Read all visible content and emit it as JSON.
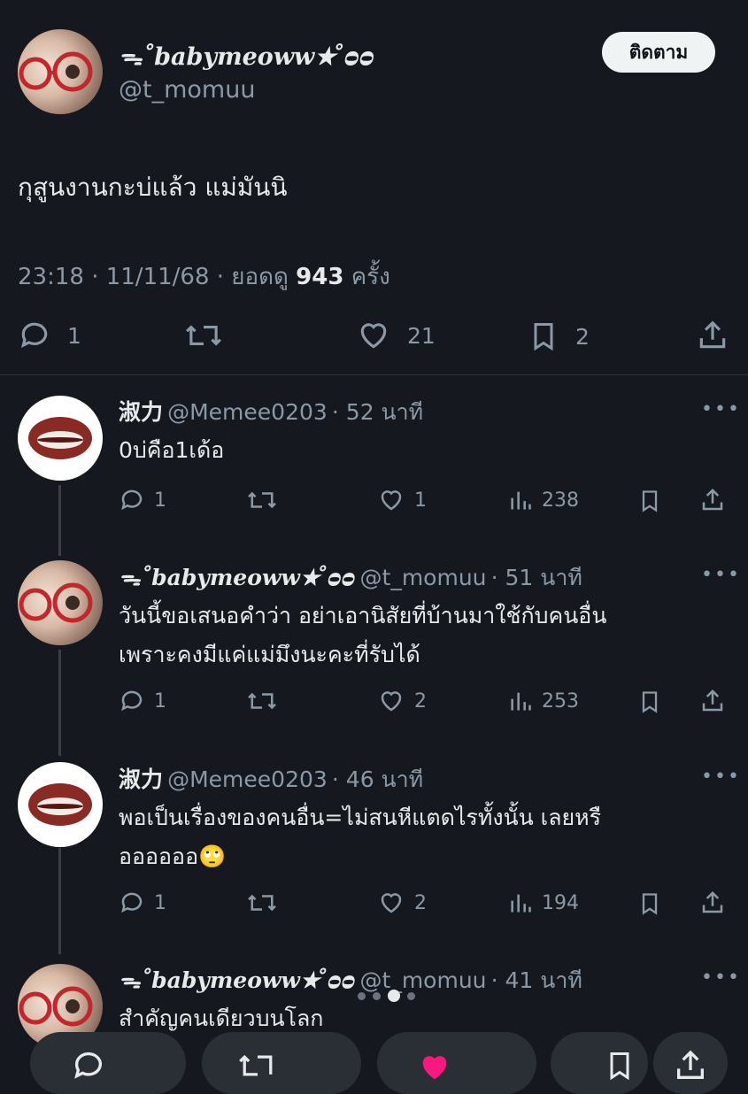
{
  "main_tweet": {
    "display_name": "ᯓ˚babymeoww★ ̊ᴑᴑ",
    "handle": "@t_momuu",
    "follow_label": "ติดตาม",
    "text": "กุสูนงานกะบ่แล้ว แม่มันนิ",
    "time": "23:18 · 11/11/68 · ยอดดู",
    "views": "943",
    "views_suffix": "ครั้ง",
    "replies": "1",
    "likes": "21",
    "bookmarks": "2"
  },
  "replies": [
    {
      "name": "淑力",
      "handle": "@Memee0203",
      "time": "· 52 นาที",
      "text": [
        "0บ่คือ1เด้อ"
      ],
      "replies": "1",
      "likes": "1",
      "views": "238"
    },
    {
      "name": "ᯓ˚babymeoww★ ̊ᴑᴑ",
      "handle": "@t_momuu",
      "time": "· 51 นาที",
      "text": [
        "วันนี้ขอเสนอคำว่า อย่าเอานิสัยที่บ้านมาใช้กับคนอื่น",
        "เพราะคงมีแค่แม่มึงนะคะที่รับได้"
      ],
      "replies": "1",
      "likes": "2",
      "views": "253"
    },
    {
      "name": "淑力",
      "handle": "@Memee0203",
      "time": "· 46 นาที",
      "text": [
        "พอเป็นเรื่องของคนอื่น=ไม่สนหีแตดไรทั้งนั้น เลยหรื",
        "ออออออ🙄"
      ],
      "replies": "1",
      "likes": "2",
      "views": "194"
    },
    {
      "name": "ᯓ˚babymeoww★ ̊ᴑᴑ",
      "handle": "@t_momuu",
      "time": "· 41 นาที",
      "text": [
        "สำคัญคนเดียวบนโลก"
      ]
    }
  ],
  "more_label": "•••",
  "colors": {
    "background": "#15181e",
    "text": "#e7e9ea",
    "muted": "#8b98a5",
    "like_pink": "#f91880"
  }
}
